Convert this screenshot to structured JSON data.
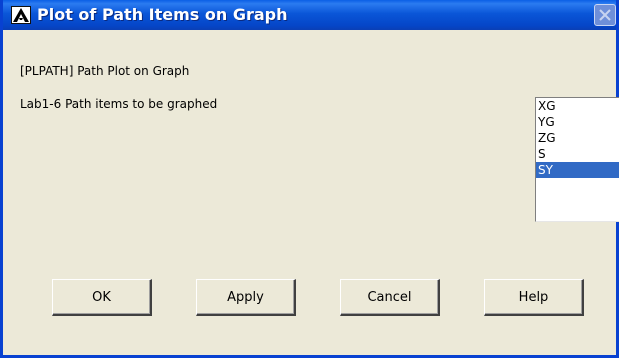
{
  "window": {
    "title": "Plot of Path Items on Graph"
  },
  "command_label": "[PLPATH]  Path Plot on Graph",
  "field_label": "Lab1-6  Path items to be graphed",
  "listbox": {
    "items": [
      "XG",
      "YG",
      "ZG",
      "S",
      "SY"
    ],
    "selected": "SY"
  },
  "buttons": {
    "ok": "OK",
    "apply": "Apply",
    "cancel": "Cancel",
    "help": "Help"
  },
  "colors": {
    "titlebar": "#0a56d8",
    "dialog_background": "#ece9d8",
    "selection": "#316ac5"
  },
  "icons": {
    "app": "ansys-logo-icon",
    "close": "close-icon"
  }
}
